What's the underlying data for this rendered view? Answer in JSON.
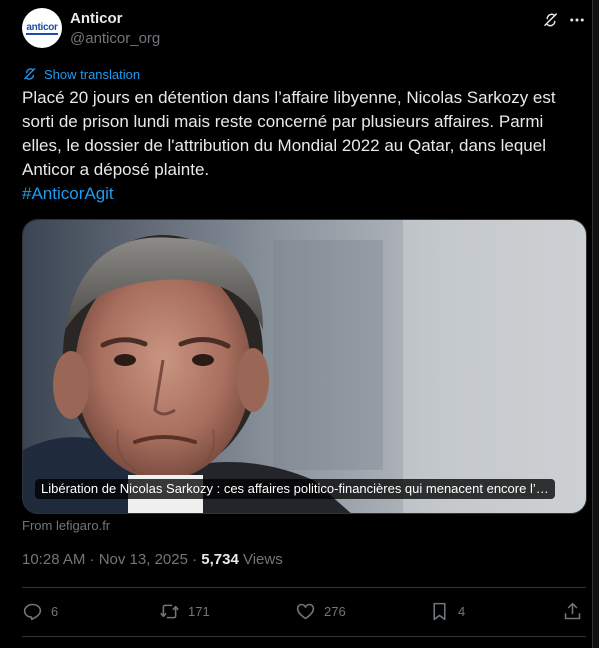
{
  "author": {
    "name": "Anticor",
    "handle": "@anticor_org",
    "avatar_text": "anticor"
  },
  "translate": {
    "label": "Show translation"
  },
  "tweet": {
    "text": "Placé 20 jours en détention dans l’affaire libyenne, Nicolas Sarkozy est sorti de prison lundi mais reste concerné par plusieurs affaires. Parmi elles, le dossier de l'attribution du Mondial 2022 au Qatar, dans lequel Anticor a déposé plainte.",
    "hashtag": "#AnticorAgit"
  },
  "card": {
    "caption": "Libération de Nicolas Sarkozy : ces affaires politico-financières qui menacent encore l’…",
    "source": "From lefigaro.fr"
  },
  "meta": {
    "time_date": "10:28 AM · Nov 13, 2025 · ",
    "views_count": "5,734",
    "views_label": " Views"
  },
  "actions": {
    "replies": "6",
    "reposts": "171",
    "likes": "276",
    "bookmarks": "4"
  },
  "colors": {
    "background": "#000000",
    "text": "#e7e9ea",
    "secondary_text": "#71767b",
    "accent": "#1d9bf0",
    "border": "#2f3336"
  },
  "icons": [
    "grok-icon",
    "more-icon",
    "translate-icon",
    "reply-icon",
    "repost-icon",
    "like-icon",
    "bookmark-icon",
    "share-icon"
  ]
}
